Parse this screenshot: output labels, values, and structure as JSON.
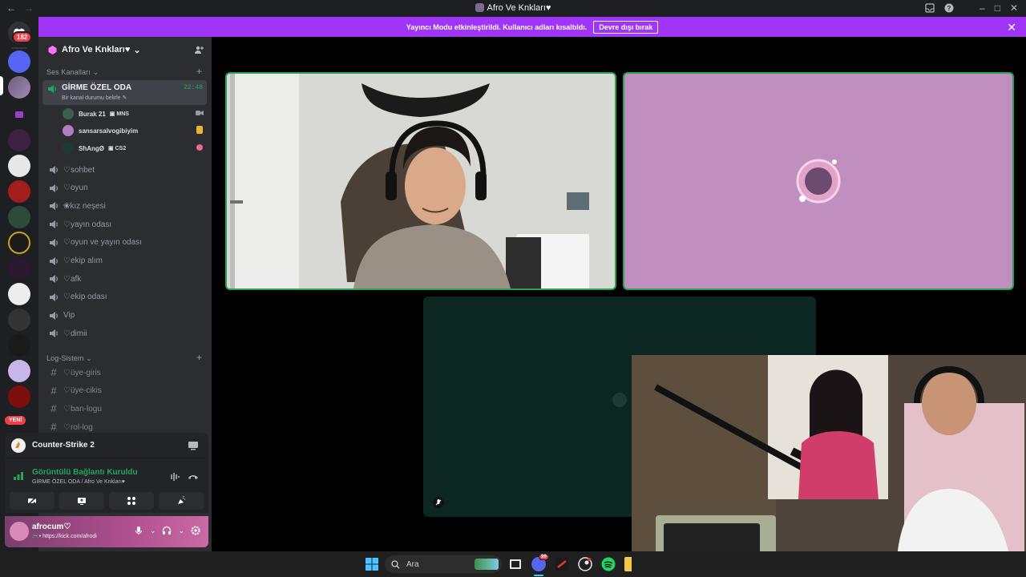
{
  "window": {
    "title": "Afro Ve Knkları♥"
  },
  "notice": {
    "text": "Yayıncı Modu etkinleştirildi. Kullanıcı adları kısaltıldı.",
    "button": "Devre dışı bırak",
    "color": "#a035f7"
  },
  "rail": {
    "dm_badge": "182",
    "new_badge": "YENİ",
    "server_count": 15
  },
  "server": {
    "name": "Afro Ve Knkları♥"
  },
  "categories": {
    "voice": "Ses Kanalları",
    "log": "Log-Sistem"
  },
  "active_channel": {
    "name": "GİRME ÖZEL ODA",
    "status": "Bir kanal durumu belirle",
    "time": "22:48"
  },
  "voice_users": [
    {
      "name": "Burak 21",
      "tag": "MNS",
      "avatar_color": "#3a5f4e"
    },
    {
      "name": "sansarsalvogibiyim",
      "tag": "",
      "avatar_color": "#b07dc0"
    },
    {
      "name": "SħAngØ",
      "tag": "CS2",
      "avatar_color": "#1e3b33"
    }
  ],
  "voice_channels": [
    "♡sohbet",
    "♡oyun",
    "❀kız neşesi",
    "♡yayın odası",
    "♡oyun ve yayın odası",
    "♡ekip alım",
    "♡afk",
    "♡ekip odası",
    "Vip",
    "♡dimii"
  ],
  "log_channels": [
    "♡üye-giris",
    "♡üye-cikis",
    "♡ban-logu",
    "♡rol-log"
  ],
  "activity": {
    "game": "Counter-Strike 2"
  },
  "voice_connection": {
    "status": "Görüntülü Bağlantı Kuruldu",
    "location": "GİRME ÖZEL ODA / Afro Ve Knkları♥"
  },
  "user": {
    "name": "afrocum♡",
    "status": "• https://kick.com/afrodi"
  },
  "taskbar": {
    "search": "Ara",
    "discord_badge": "99"
  },
  "colors": {
    "accent_green": "#23a55a",
    "sidebar": "#2b2d31",
    "rail": "#1e1f22"
  }
}
